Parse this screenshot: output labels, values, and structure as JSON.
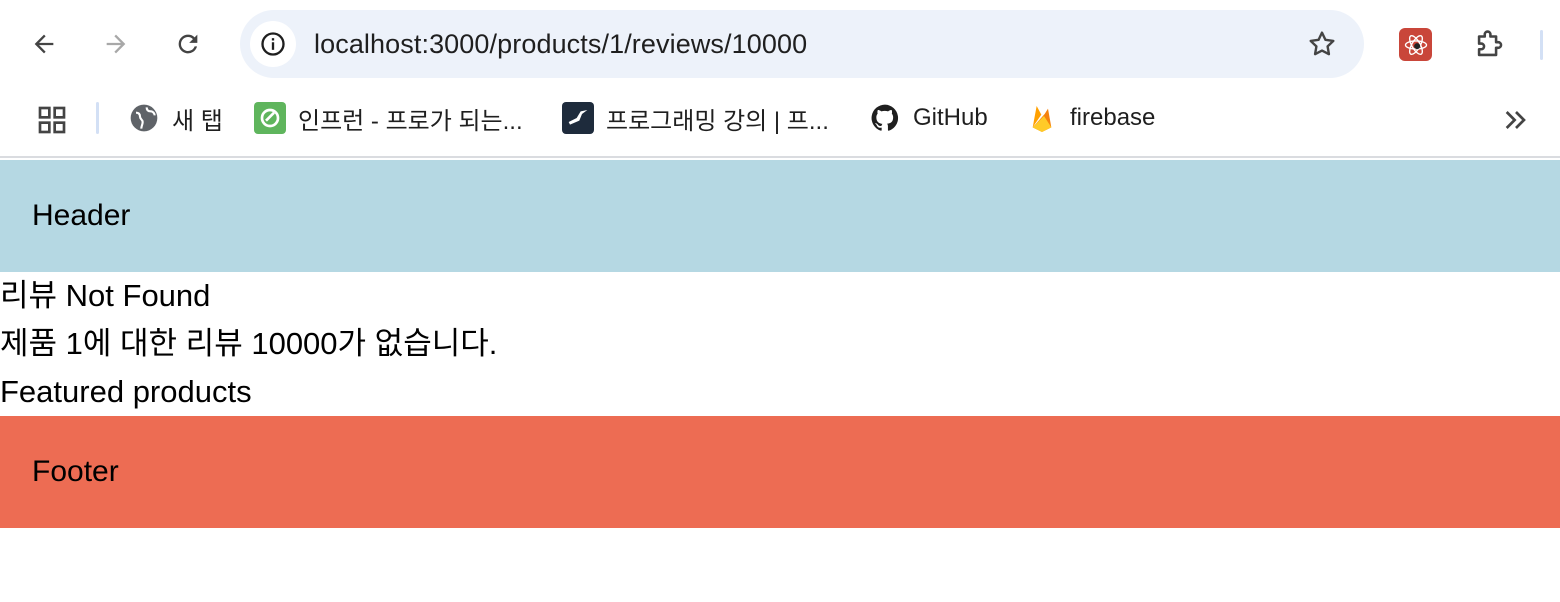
{
  "browser": {
    "url": "localhost:3000/products/1/reviews/10000",
    "bookmarks": [
      {
        "label": "새 탭",
        "icon": "globe-icon"
      },
      {
        "label": "인프런 - 프로가 되는...",
        "icon": "inflearn-icon"
      },
      {
        "label": "프로그래밍 강의 | 프...",
        "icon": "hummingbird-icon"
      },
      {
        "label": "GitHub",
        "icon": "github-icon"
      },
      {
        "label": "firebase",
        "icon": "firebase-icon"
      }
    ]
  },
  "page": {
    "header": "Header",
    "heading": "리뷰 Not Found",
    "message": "제품 1에 대한 리뷰 10000가 없습니다.",
    "featured": "Featured products",
    "footer": "Footer"
  },
  "colors": {
    "header_bg": "#b5d8e3",
    "footer_bg": "#ed6c53",
    "omnibox_bg": "#edf2fa"
  }
}
